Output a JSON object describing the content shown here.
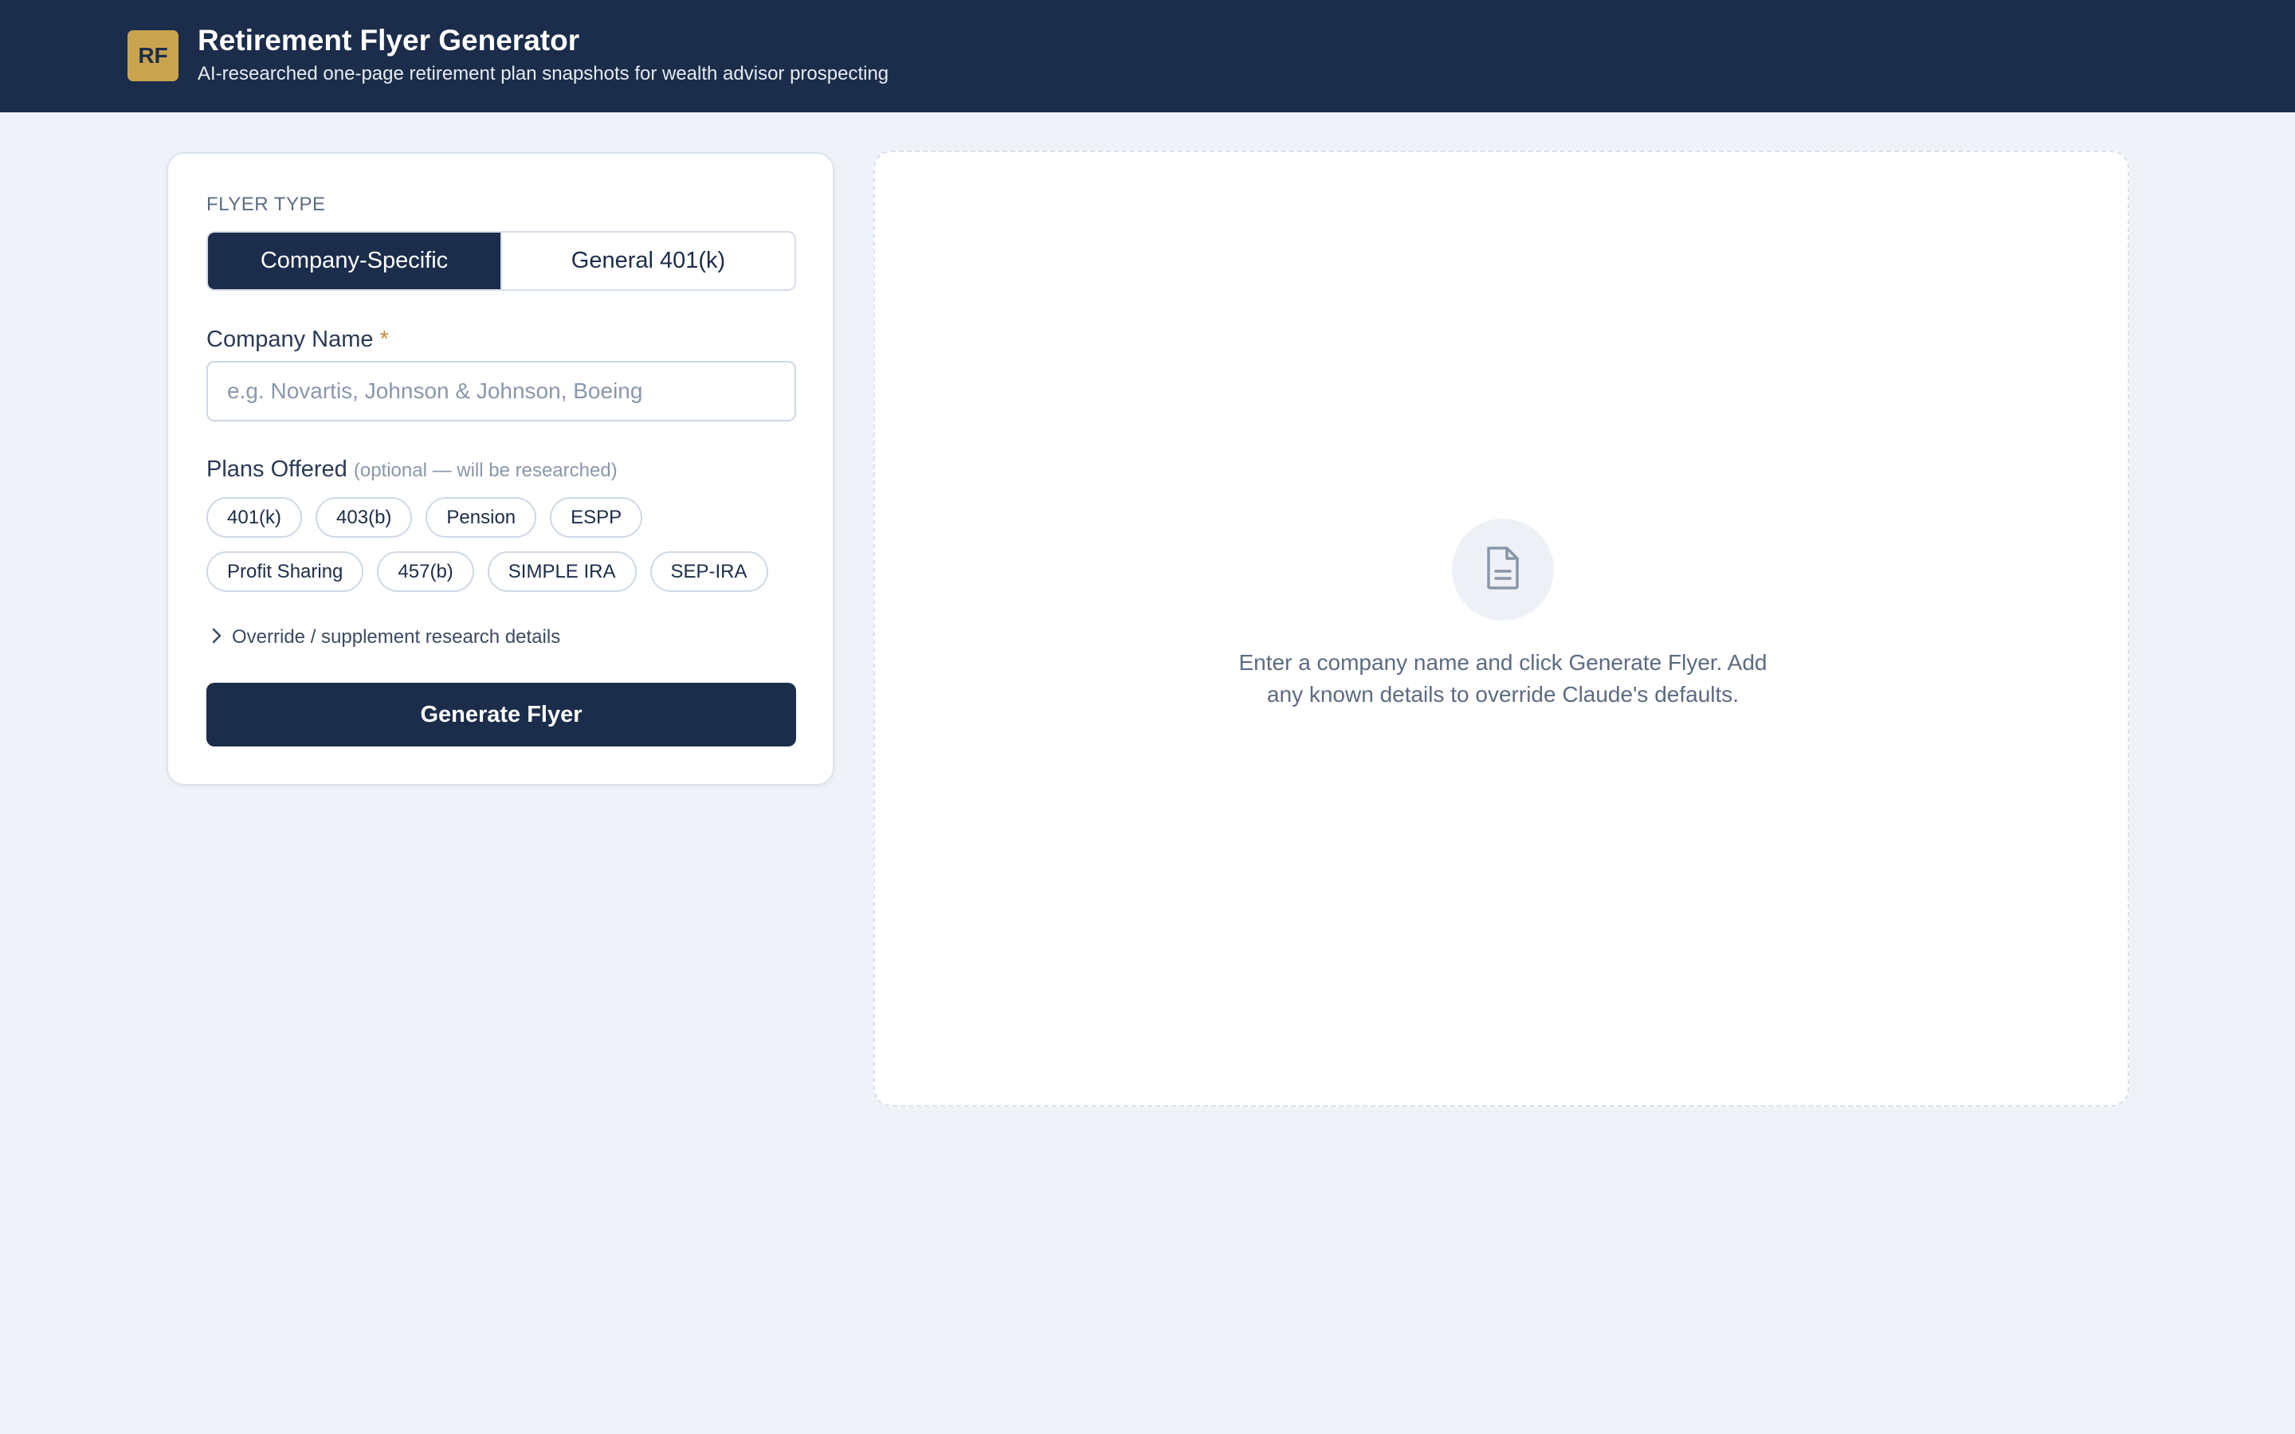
{
  "header": {
    "logo_text": "RF",
    "title": "Retirement Flyer Generator",
    "subtitle": "AI-researched one-page retirement plan snapshots for wealth advisor prospecting"
  },
  "form": {
    "flyer_type_label": "FLYER TYPE",
    "flyer_types": [
      "Company-Specific",
      "General 401(k)"
    ],
    "selected_flyer_type": "Company-Specific",
    "company_name_label": "Company Name",
    "required_marker": "*",
    "company_name_value": "",
    "company_name_placeholder": "e.g. Novartis, Johnson & Johnson, Boeing",
    "plans_label": "Plans Offered",
    "plans_note": "(optional — will be researched)",
    "plans": [
      "401(k)",
      "403(b)",
      "Pension",
      "ESPP",
      "Profit Sharing",
      "457(b)",
      "SIMPLE IRA",
      "SEP-IRA"
    ],
    "override_label": "Override / supplement research details",
    "generate_label": "Generate Flyer"
  },
  "preview": {
    "icon": "document-icon",
    "empty_message": "Enter a company name and click Generate Flyer. Add any known details to override Claude's defaults."
  },
  "colors": {
    "navy": "#1b2d4a",
    "gold": "#c9a34d",
    "background": "#eff3f8"
  }
}
